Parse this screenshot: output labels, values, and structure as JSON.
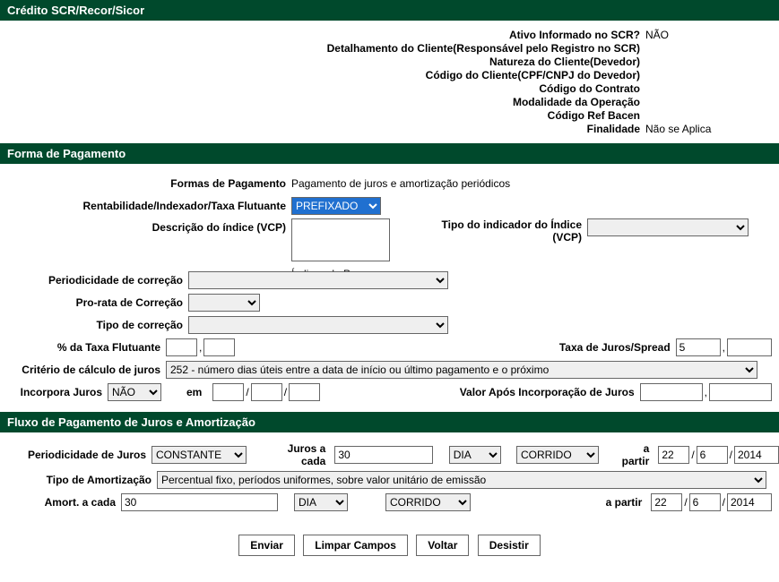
{
  "scr": {
    "title": "Crédito SCR/Recor/Sicor",
    "rows": [
      {
        "label": "Ativo Informado no SCR?",
        "value": "NÃO"
      },
      {
        "label": "Detalhamento do Cliente(Responsável pelo Registro no SCR)",
        "value": ""
      },
      {
        "label": "Natureza do Cliente(Devedor)",
        "value": ""
      },
      {
        "label": "Código do Cliente(CPF/CNPJ do Devedor)",
        "value": ""
      },
      {
        "label": "Código do Contrato",
        "value": ""
      },
      {
        "label": "Modalidade da Operação",
        "value": ""
      },
      {
        "label": "Código Ref Bacen",
        "value": ""
      },
      {
        "label": "Finalidade",
        "value": "Não se Aplica"
      }
    ]
  },
  "pagamento": {
    "title": "Forma de Pagamento",
    "formas_label": "Formas de Pagamento",
    "formas_value": "Pagamento de juros e amortização periódicos",
    "rentabilidade_label": "Rentabilidade/Indexador/Taxa Flutuante",
    "rentabilidade_value": "PREFIXADO",
    "descricao_indice_label": "Descrição do índice (VCP)",
    "tipo_indicador_label": "Tipo do indicador do Índice (VCP)",
    "indices_precos_label": "Índices de Preços",
    "periodicidade_correcao_label": "Periodicidade de correção",
    "prorata_label": "Pro-rata de Correção",
    "tipo_correcao_label": "Tipo de correção",
    "pct_taxa_label": "% da Taxa Flutuante",
    "taxa_juros_label": "Taxa de Juros/Spread",
    "taxa_juros_value": "5",
    "criterio_label": "Critério de cálculo de juros",
    "criterio_value": "252 - número dias úteis entre a data de início ou último pagamento e o próximo",
    "incorpora_label": "Incorpora Juros",
    "incorpora_value": "NÃO",
    "em_label": "em",
    "valor_apos_label": "Valor Após Incorporação de Juros"
  },
  "fluxo": {
    "title": "Fluxo de Pagamento de Juros e Amortização",
    "periodicidade_juros_label": "Periodicidade de Juros",
    "periodicidade_juros_value": "CONSTANTE",
    "juros_cada_label": "Juros a cada",
    "juros_cada_value": "30",
    "juros_unit_value": "DIA",
    "juros_tipo_value": "CORRIDO",
    "a_partir_label": "a partir",
    "juros_d": "22",
    "juros_m": "6",
    "juros_y": "2014",
    "tipo_amort_label": "Tipo de Amortização",
    "tipo_amort_value": "Percentual fixo, períodos uniformes, sobre valor unitário de emissão",
    "amort_cada_label": "Amort. a cada",
    "amort_cada_value": "30",
    "amort_unit_value": "DIA",
    "amort_tipo_value": "CORRIDO",
    "amort_d": "22",
    "amort_m": "6",
    "amort_y": "2014"
  },
  "buttons": {
    "enviar": "Enviar",
    "limpar": "Limpar Campos",
    "voltar": "Voltar",
    "desistir": "Desistir"
  },
  "slash": "/",
  "comma": ","
}
